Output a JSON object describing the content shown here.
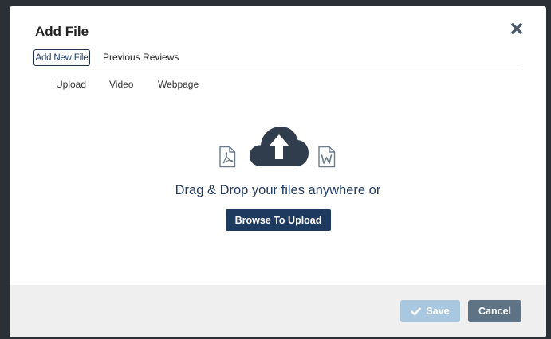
{
  "dialog": {
    "title": "Add File",
    "close_icon": "close-icon"
  },
  "tabs": [
    {
      "label": "Add New File",
      "active": true
    },
    {
      "label": "Previous Reviews",
      "active": false
    }
  ],
  "subtabs": [
    {
      "label": "Upload"
    },
    {
      "label": "Video"
    },
    {
      "label": "Webpage"
    }
  ],
  "upload": {
    "icons": [
      "pdf-file-icon",
      "cloud-upload-icon",
      "word-file-icon"
    ],
    "drag_text": "Drag & Drop your files anywhere or",
    "browse_label": "Browse To Upload"
  },
  "footer": {
    "save_label": "Save",
    "save_icon": "checkmark-icon",
    "cancel_label": "Cancel"
  },
  "colors": {
    "primary": "#1f3a5f",
    "save_disabled": "#a9c7df",
    "cancel": "#5f7386",
    "footer_bg": "#efefef"
  }
}
